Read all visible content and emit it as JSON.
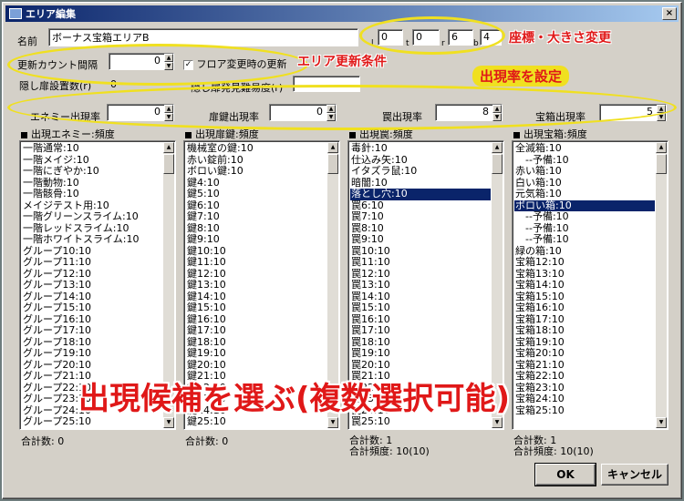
{
  "window": {
    "title": "エリア編集",
    "close_glyph": "×"
  },
  "form": {
    "name_label": "名前",
    "name_value": "ボーナス宝箱エリアB",
    "coords": [
      {
        "label": "l",
        "value": "0"
      },
      {
        "label": "t",
        "value": "0"
      },
      {
        "label": "r",
        "value": "6"
      },
      {
        "label": "b",
        "value": "4"
      }
    ],
    "update_interval_label": "更新カウント間隔",
    "update_interval_value": "0",
    "floor_change_checkbox_label": "フロア変更時の更新",
    "floor_change_checked": true,
    "check_glyph": "✓",
    "hidden_door_count_label": "隠し扉設置数(r)",
    "hidden_door_count_value": "0",
    "hidden_door_difficulty_label": "隠し扉発見難易度(r)",
    "hidden_door_difficulty_value": "",
    "rates": [
      {
        "label": "エネミー出現率",
        "value": "0"
      },
      {
        "label": "扉鍵出現率",
        "value": "0"
      },
      {
        "label": "罠出現率",
        "value": "8"
      },
      {
        "label": "宝箱出現率",
        "value": "5"
      }
    ]
  },
  "lists": [
    {
      "header": "出現エネミー:頻度",
      "items": [
        "一階通常:10",
        "一階メイジ:10",
        "一階にぎやか:10",
        "一階動物:10",
        "一階骸骨:10",
        "メイジテスト用:10",
        "一階グリーンスライム:10",
        "一階レッドスライム:10",
        "一階ホワイトスライム:10",
        "グループ10:10",
        "グループ11:10",
        "グループ12:10",
        "グループ13:10",
        "グループ14:10",
        "グループ15:10",
        "グループ16:10",
        "グループ17:10",
        "グループ18:10",
        "グループ19:10",
        "グループ20:10",
        "グループ21:10",
        "グループ22:10",
        "グループ23:10",
        "グループ24:10",
        "グループ25:10"
      ],
      "selected_index": -1,
      "footer": [
        "合計数: 0"
      ]
    },
    {
      "header": "出現扉鍵:頻度",
      "items": [
        "機械室の鍵:10",
        "赤い錠前:10",
        "ボロい鍵:10",
        "鍵4:10",
        "鍵5:10",
        "鍵6:10",
        "鍵7:10",
        "鍵8:10",
        "鍵9:10",
        "鍵10:10",
        "鍵11:10",
        "鍵12:10",
        "鍵13:10",
        "鍵14:10",
        "鍵15:10",
        "鍵16:10",
        "鍵17:10",
        "鍵18:10",
        "鍵19:10",
        "鍵20:10",
        "鍵21:10",
        "鍵22:10",
        "鍵23:10",
        "鍵24:10",
        "鍵25:10"
      ],
      "selected_index": -1,
      "footer": [
        "合計数: 0"
      ]
    },
    {
      "header": "出現罠:頻度",
      "items": [
        "毒針:10",
        "仕込み矢:10",
        "イタズラ鼠:10",
        "暗闇:10",
        "落とし穴:10",
        "罠6:10",
        "罠7:10",
        "罠8:10",
        "罠9:10",
        "罠10:10",
        "罠11:10",
        "罠12:10",
        "罠13:10",
        "罠14:10",
        "罠15:10",
        "罠16:10",
        "罠17:10",
        "罠18:10",
        "罠19:10",
        "罠20:10",
        "罠21:10",
        "罠22:10",
        "罠23:10",
        "罠24:10",
        "罠25:10"
      ],
      "selected_index": 4,
      "footer": [
        "合計数: 1",
        "合計頻度: 10(10)"
      ]
    },
    {
      "header": "出現宝箱:頻度",
      "items": [
        "全滅箱:10",
        "--予備:10",
        "赤い箱:10",
        "白い箱:10",
        "元気箱:10",
        "ボロい箱:10",
        "--予備:10",
        "--予備:10",
        "--予備:10",
        "緑の箱:10",
        "宝箱12:10",
        "宝箱13:10",
        "宝箱14:10",
        "宝箱15:10",
        "宝箱16:10",
        "宝箱17:10",
        "宝箱18:10",
        "宝箱19:10",
        "宝箱20:10",
        "宝箱21:10",
        "宝箱22:10",
        "宝箱23:10",
        "宝箱24:10",
        "宝箱25:10"
      ],
      "indent_indices": [
        1,
        6,
        7,
        8
      ],
      "selected_index": 5,
      "footer": [
        "合計数: 1",
        "合計頻度: 10(10)"
      ]
    }
  ],
  "buttons": {
    "ok_label": "OK",
    "cancel_label": "キャンセル"
  },
  "annotations": {
    "coords_note": "座標・大きさ変更",
    "update_note": "エリア更新条件",
    "rate_note": "出現率を設定",
    "select_note": "出現候補を選ぶ(複数選択可能)",
    "highlight_color": "#f0e020",
    "text_color": "#e01818"
  }
}
